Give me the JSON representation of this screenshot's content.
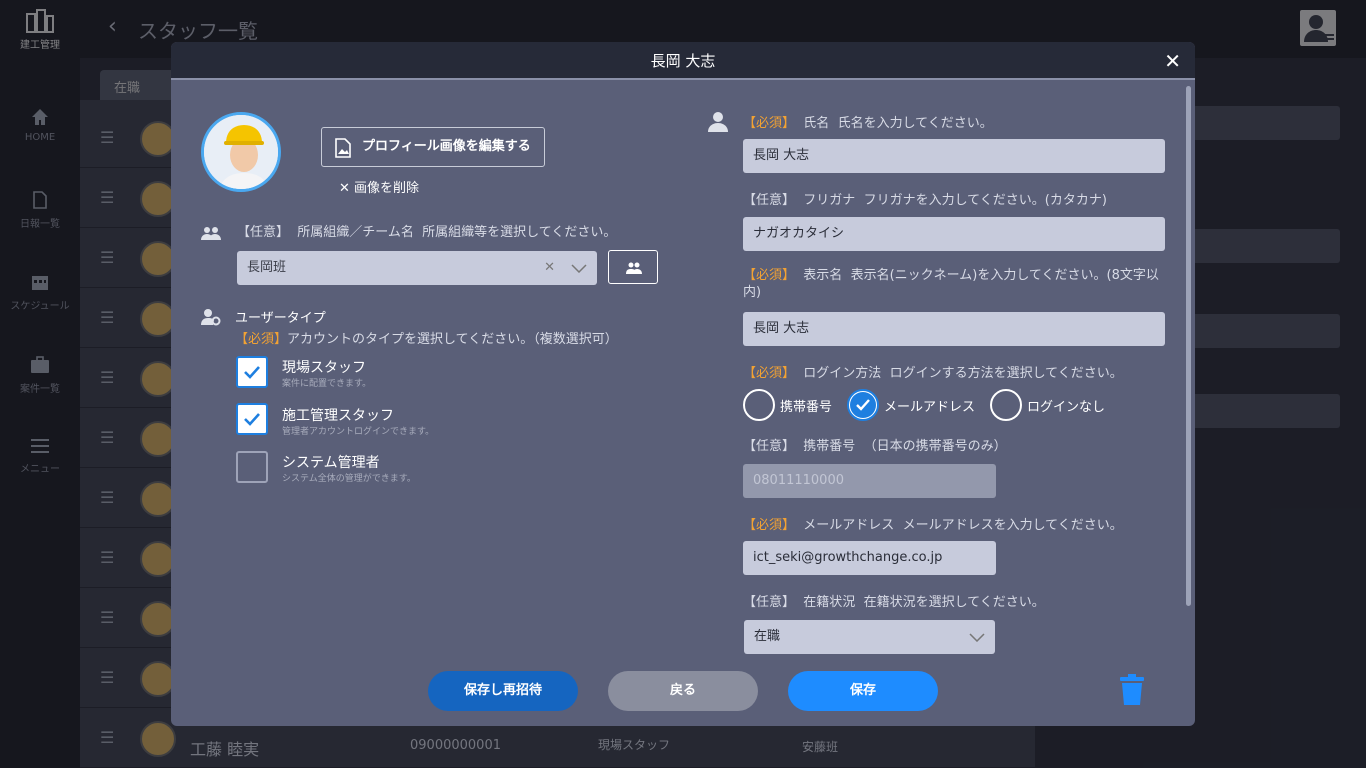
{
  "app": {
    "logo_text": "建工管理",
    "page_title": "スタッフ一覧"
  },
  "sidebar": {
    "items": [
      {
        "label": "HOME",
        "icon": "home-icon"
      },
      {
        "label": "日報一覧",
        "icon": "document-icon"
      },
      {
        "label": "スケジュール",
        "icon": "calendar-icon"
      },
      {
        "label": "案件一覧",
        "icon": "briefcase-icon"
      },
      {
        "label": "メニュー",
        "icon": "menu-icon"
      }
    ]
  },
  "background": {
    "tab_label": "在職",
    "last_row": {
      "name": "工藤 睦実",
      "phone": "09000000001",
      "type": "現場スタッフ",
      "team": "安藤班"
    }
  },
  "modal": {
    "title": "長岡 大志",
    "edit_image_label": "プロフィール画像を編集する",
    "delete_image_label": "画像を削除",
    "team": {
      "tag": "【任意】",
      "label": "所属組織／チーム名",
      "hint": "所属組織等を選択してください。",
      "value": "長岡班"
    },
    "user_type": {
      "label": "ユーザータイプ",
      "tag": "【必須】",
      "hint": "アカウントのタイプを選択してください。（複数選択可）",
      "options": [
        {
          "title": "現場スタッフ",
          "sub": "案件に配置できます。",
          "checked": true
        },
        {
          "title": "施工管理スタッフ",
          "sub": "管理者アカウントログインできます。",
          "checked": true
        },
        {
          "title": "システム管理者",
          "sub": "システム全体の管理ができます。",
          "checked": false
        }
      ]
    },
    "name": {
      "tag": "【必須】",
      "label": "氏名",
      "hint": "氏名を入力してください。",
      "value": "長岡 大志"
    },
    "furigana": {
      "tag": "【任意】",
      "label": "フリガナ",
      "hint": "フリガナを入力してください。(カタカナ)",
      "value": "ナガオカタイシ"
    },
    "display_name": {
      "tag": "【必須】",
      "label": "表示名",
      "hint": "表示名(ニックネーム)を入力してください。(8文字以内)",
      "value": "長岡 大志"
    },
    "login_method": {
      "tag": "【必須】",
      "label": "ログイン方法",
      "hint": "ログインする方法を選択してください。",
      "options": [
        {
          "label": "携帯番号",
          "selected": false
        },
        {
          "label": "メールアドレス",
          "selected": true
        },
        {
          "label": "ログインなし",
          "selected": false
        }
      ]
    },
    "mobile": {
      "tag": "【任意】",
      "label": "携帯番号",
      "hint": "（日本の携帯番号のみ）",
      "placeholder": "08011110000"
    },
    "email": {
      "tag": "【必須】",
      "label": "メールアドレス",
      "hint": "メールアドレスを入力してください。",
      "value": "ict_seki@growthchange.co.jp"
    },
    "status": {
      "tag": "【任意】",
      "label": "在籍状況",
      "hint": "在籍状況を選択してください。",
      "value": "在職"
    },
    "buttons": {
      "reinvite": "保存し再招待",
      "back": "戻る",
      "save": "保存"
    },
    "colors": {
      "required": "#f2a233",
      "primary": "#1e8cff",
      "reinvite": "#1565c0",
      "back": "#8a8e9e"
    }
  }
}
